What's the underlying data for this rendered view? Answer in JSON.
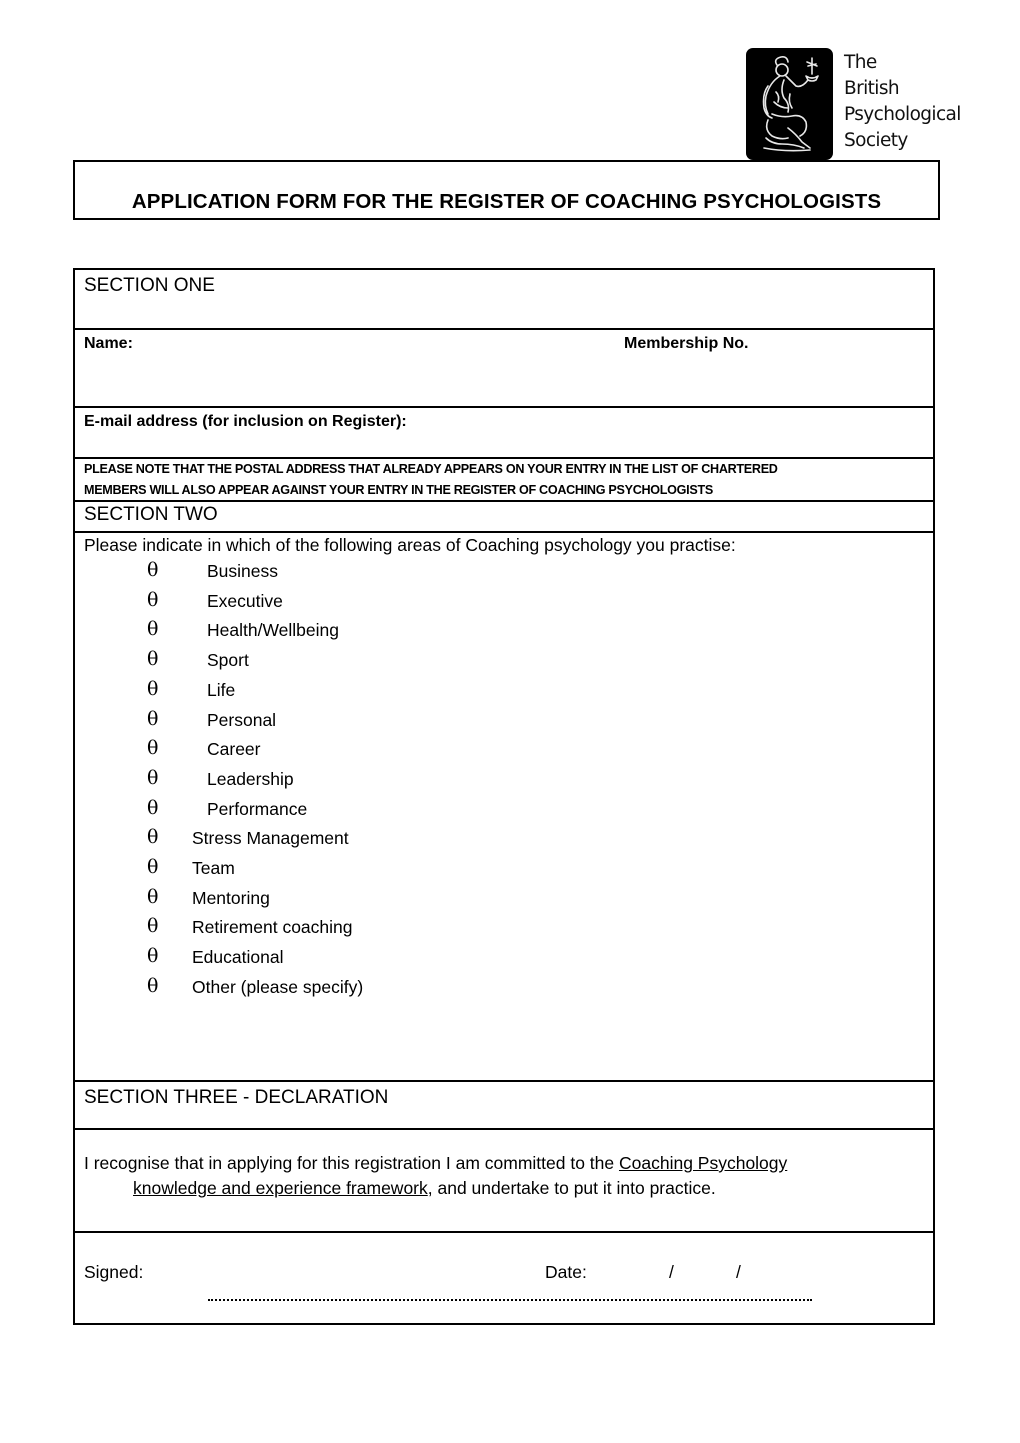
{
  "logo": {
    "icon": "bps-figure-logo-icon",
    "lines": [
      "The",
      "British",
      "Psychological",
      "Society"
    ]
  },
  "document": {
    "title": "APPLICATION FORM FOR THE REGISTER OF COACHING PSYCHOLOGISTS"
  },
  "section_one": {
    "heading": "SECTION ONE",
    "name_label": "Name:",
    "name_value": "",
    "membership_label": "Membership No.",
    "membership_value": "",
    "email_label": "E-mail address (for inclusion on Register):",
    "email_value": "",
    "note_line1": "PLEASE NOTE THAT THE POSTAL ADDRESS THAT ALREADY APPEARS ON YOUR ENTRY IN THE LIST OF CHARTERED",
    "note_line2": "MEMBERS WILL ALSO APPEAR AGAINST YOUR ENTRY IN THE REGISTER OF COACHING PSYCHOLOGISTS"
  },
  "section_two": {
    "heading": "SECTION TWO",
    "instruction": "Please indicate in which of the following areas of Coaching psychology you practise:",
    "bullet_glyph": "θ",
    "areas": [
      {
        "label": "Business",
        "checked": false
      },
      {
        "label": "Executive",
        "checked": false
      },
      {
        "label": "Health/Wellbeing",
        "checked": false
      },
      {
        "label": "Sport",
        "checked": false
      },
      {
        "label": "Life",
        "checked": false
      },
      {
        "label": "Personal",
        "checked": false
      },
      {
        "label": "Career",
        "checked": false
      },
      {
        "label": "Leadership",
        "checked": false
      },
      {
        "label": "Performance",
        "checked": false
      },
      {
        "label": "Stress Management",
        "checked": false
      },
      {
        "label": "Team",
        "checked": false
      },
      {
        "label": "Mentoring",
        "checked": false
      },
      {
        "label": "Retirement coaching",
        "checked": false
      },
      {
        "label": "Educational",
        "checked": false
      },
      {
        "label": "Other (please specify)",
        "checked": false
      }
    ],
    "other_specify_value": ""
  },
  "section_three": {
    "heading": "SECTION THREE - DECLARATION",
    "declaration_before": "I recognise that in applying for this registration I am committed to the ",
    "declaration_link_part1": "Coaching Psychology ",
    "declaration_link_part2": "knowledge and experience framework",
    "declaration_after": ", and undertake to put it into practice.",
    "signed_label": "Signed:",
    "date_label": "Date:",
    "date_separator": "/"
  }
}
